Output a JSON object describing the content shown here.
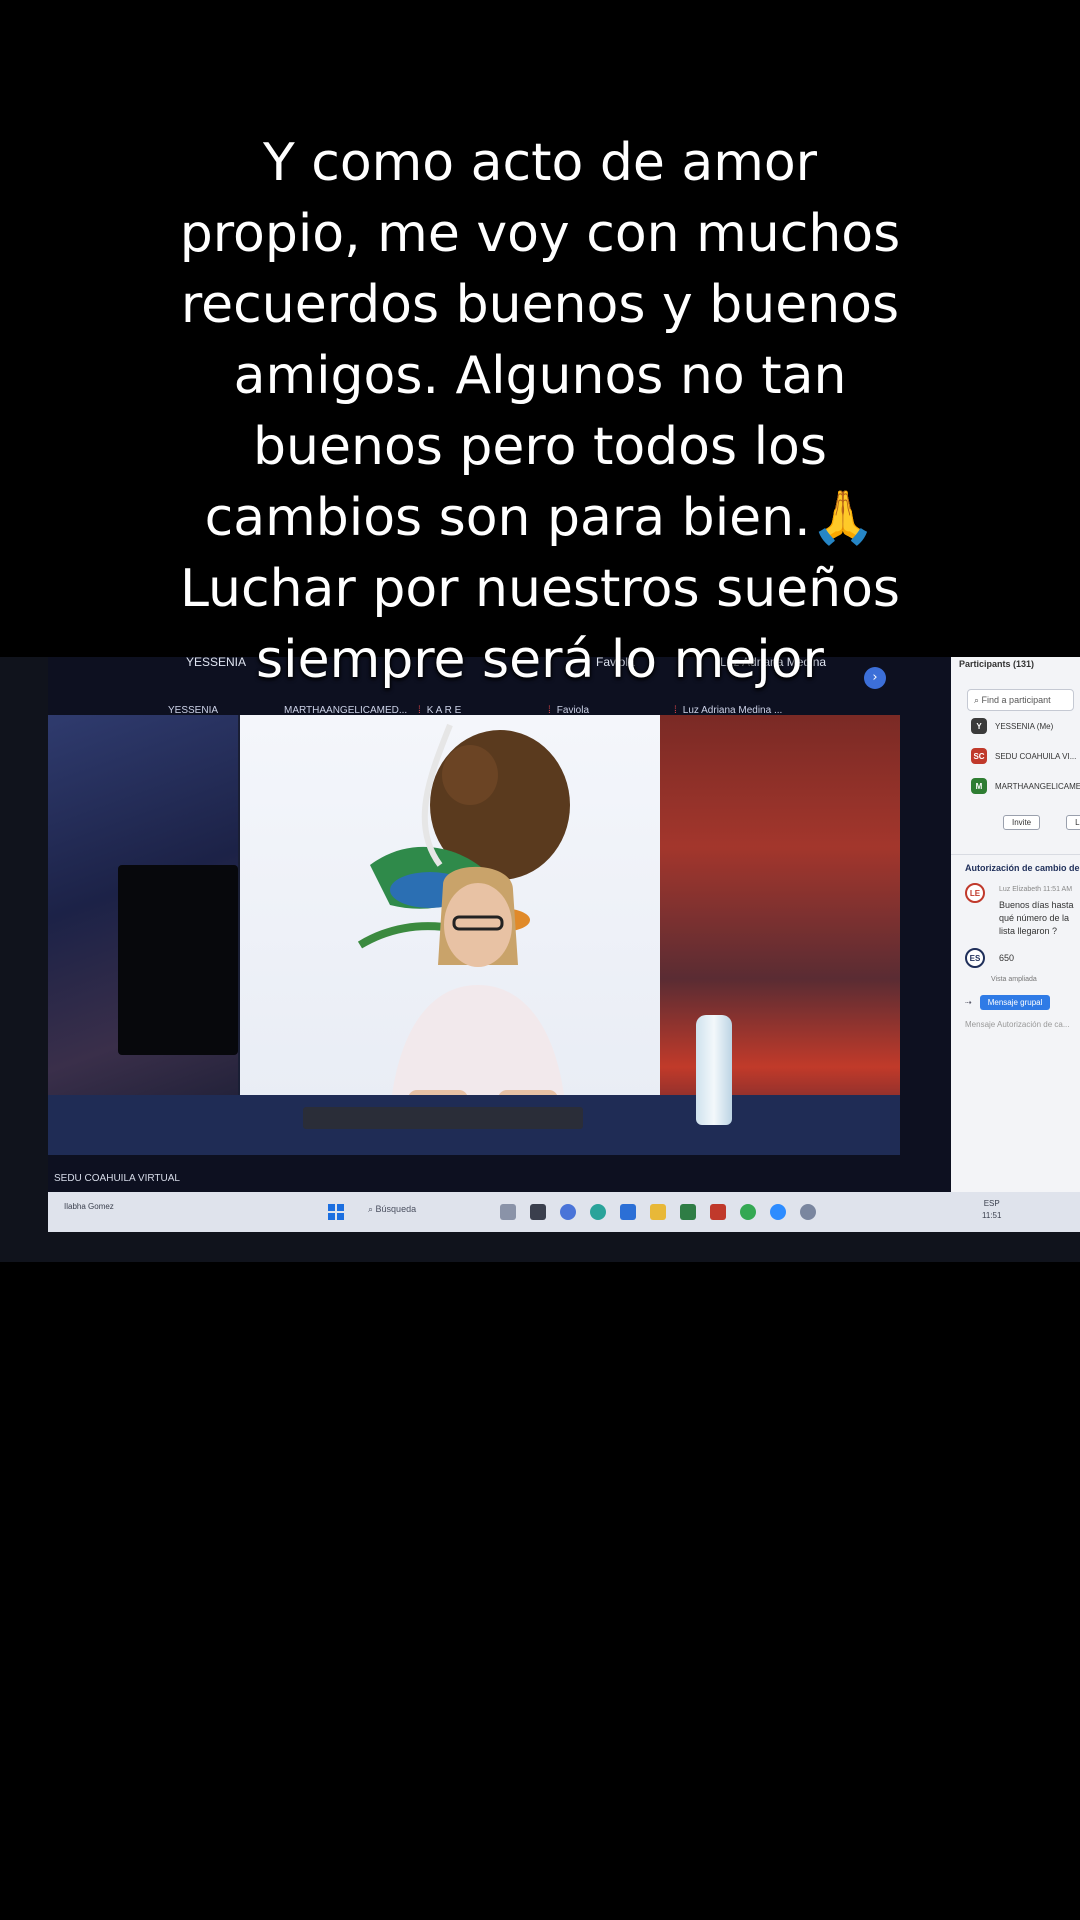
{
  "caption": {
    "lines": [
      "Y como acto de amor",
      "propio, me voy con muchos",
      "recuerdos buenos y buenos",
      "amigos. Algunos no tan",
      "buenos pero todos los",
      "cambios son para bien.🙏",
      "Luchar por nuestros sueños",
      "siempre será lo mejor"
    ]
  },
  "meeting": {
    "top_tiles": [
      "YESSENIA",
      "Faviola",
      "Luz Adriana Medina"
    ],
    "tile_names": [
      "YESSENIA",
      "MARTHAANGELICAMED...",
      "K A R E",
      "Faviola",
      "Luz Adriana Medina ..."
    ],
    "bottom_label": "SEDU COAHUILA VIRTUAL",
    "scroll_icon": "chevron-right-icon"
  },
  "participants_panel": {
    "title": "Participants (131)",
    "search_placeholder": "Find a participant",
    "participants": [
      {
        "initials": "Y",
        "name": "YESSENIA (Me)",
        "color": "#3a3a3a"
      },
      {
        "initials": "SC",
        "name": "SEDU COAHUILA VI...",
        "color": "#c0392b"
      },
      {
        "initials": "M",
        "name": "MARTHAANGELICAMEDRA...",
        "color": "#2e7d32"
      }
    ],
    "buttons": [
      "Invite",
      "Llamar"
    ],
    "chat_title": "Autorización de cambio de Centro",
    "messages": [
      {
        "initials": "LE",
        "meta": "Luz Elizabeth 11:51 AM",
        "text": "Buenos días hasta qué número de la lista llegaron ?"
      },
      {
        "initials": "ES",
        "meta": "",
        "text": "650"
      }
    ],
    "reply_hint": "Vista ampliada",
    "send_to": "Mensaje grupal",
    "chat_placeholder": "Mensaje Autorización de ca..."
  },
  "taskbar": {
    "user": "Ilabha Gomez",
    "search_label": "Búsqueda",
    "time": "11:51",
    "lang": "ESP"
  },
  "colors": {
    "background": "#000000",
    "caption_text": "#ffffff",
    "accent": "#2f7be6"
  }
}
